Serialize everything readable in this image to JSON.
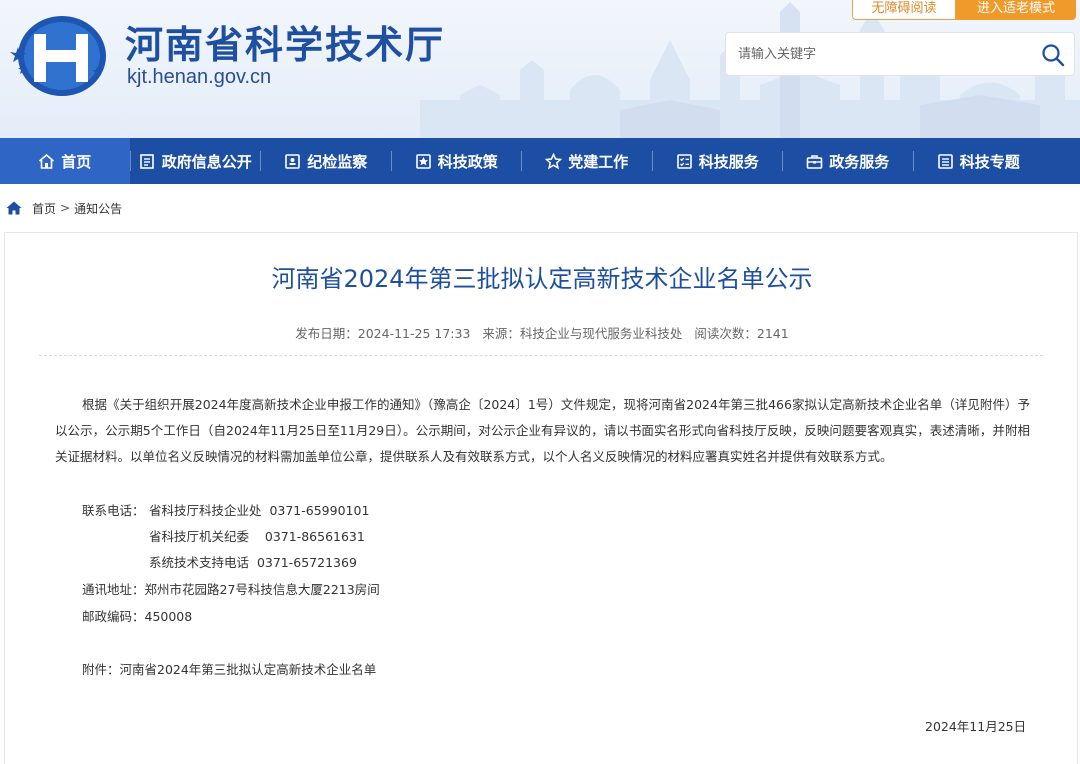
{
  "header": {
    "site_title": "河南省科学技术厅",
    "site_domain": "kjt.henan.gov.cn",
    "accessible_reading": "无障碍阅读",
    "elder_mode": "进入适老模式",
    "search_placeholder": "请输入关键字"
  },
  "nav": {
    "items": [
      {
        "label": "首页",
        "icon": "home-icon"
      },
      {
        "label": "政府信息公开",
        "icon": "document-icon"
      },
      {
        "label": "纪检监察",
        "icon": "inspection-icon"
      },
      {
        "label": "科技政策",
        "icon": "policy-icon"
      },
      {
        "label": "党建工作",
        "icon": "star-icon"
      },
      {
        "label": "科技服务",
        "icon": "checklist-icon"
      },
      {
        "label": "政务服务",
        "icon": "briefcase-icon"
      },
      {
        "label": "科技专题",
        "icon": "list-icon"
      }
    ]
  },
  "breadcrumb": {
    "home": "首页",
    "separator": ">",
    "current": "通知公告"
  },
  "article": {
    "title": "河南省2024年第三批拟认定高新技术企业名单公示",
    "publish_date": "发布日期：2024-11-25 17:33",
    "source": "来源：科技企业与现代服务业科技处",
    "read_count": "阅读次数：2141",
    "body": "根据《关于组织开展2024年度高新技术企业申报工作的通知》（豫高企〔2024〕1号）文件规定，现将河南省2024年第三批466家拟认定高新技术企业名单（详见附件）予以公示，公示期5个工作日（自2024年11月25日至11月29日）。公示期间，对公示企业有异议的，请以书面实名形式向省科技厅反映，反映问题要客观真实，表述清晰，并附相关证据材料。以单位名义反映情况的材料需加盖单位公章，提供联系人及有效联系方式，以个人名义反映情况的材料应署真实姓名并提供有效联系方式。",
    "contact_label": "联系电话：",
    "contacts": [
      "省科技厅科技企业处  0371-65990101",
      "省科技厅机关纪委    0371-86561631",
      "系统技术支持电话  0371-65721369"
    ],
    "address": "通讯地址：郑州市花园路27号科技信息大厦2213房间",
    "postcode": "邮政编码：450008",
    "attachment": "附件：河南省2024年第三批拟认定高新技术企业名单",
    "sign_date": "2024年11月25日"
  },
  "colors": {
    "brand_blue": "#1c4ea4",
    "nav_active": "#2f65c4",
    "title_blue": "#1e4f9e",
    "accent_orange": "#f09a2b"
  }
}
